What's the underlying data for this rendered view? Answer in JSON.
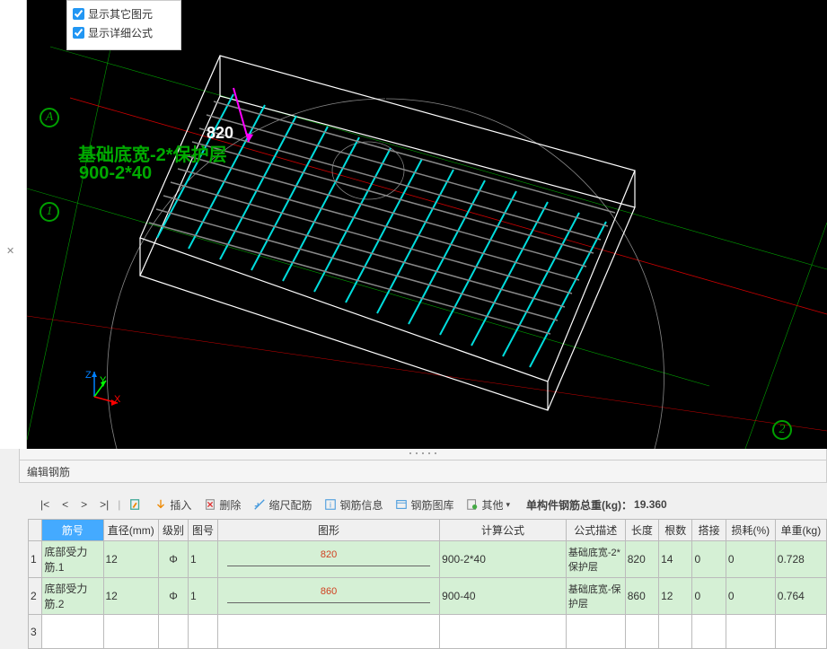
{
  "overlay": {
    "opt1": "显示其它图元",
    "opt2": "显示详细公式"
  },
  "viewport": {
    "dim820": "820",
    "formula_label": "基础底宽-2*保护层",
    "formula_calc": "900-2*40",
    "axis_x": "X",
    "axis_y": "Y",
    "axis_z": "Z",
    "marker_a": "A",
    "marker_1": "1",
    "marker_2": "2"
  },
  "panel_title": "编辑钢筋",
  "toolbar": {
    "first": "|<",
    "prev": "<",
    "next": ">",
    "last": ">|",
    "insert": "插入",
    "delete": "删除",
    "scale": "缩尺配筋",
    "info": "钢筋信息",
    "lib": "钢筋图库",
    "other": "其他",
    "total_label": "单构件钢筋总重(kg)：",
    "total_value": "19.360"
  },
  "grid": {
    "headers": {
      "h1": "筋号",
      "h2": "直径(mm)",
      "h3": "级别",
      "h4": "图号",
      "h5": "图形",
      "h6": "计算公式",
      "h7": "公式描述",
      "h8": "长度",
      "h9": "根数",
      "h10": "搭接",
      "h11": "损耗(%)",
      "h12": "单重(kg)"
    },
    "rows": [
      {
        "num": "1",
        "name": "底部受力筋.1",
        "dia": "12",
        "grade": "Φ",
        "figno": "1",
        "shape_val": "820",
        "formula": "900-2*40",
        "desc": "基础底宽-2*保护层",
        "len": "820",
        "count": "14",
        "lap": "0",
        "loss": "0",
        "weight": "0.728"
      },
      {
        "num": "2",
        "name": "底部受力筋.2",
        "dia": "12",
        "grade": "Φ",
        "figno": "1",
        "shape_val": "860",
        "formula": "900-40",
        "desc": "基础底宽-保护层",
        "len": "860",
        "count": "12",
        "lap": "0",
        "loss": "0",
        "weight": "0.764"
      },
      {
        "num": "3",
        "name": "",
        "dia": "",
        "grade": "",
        "figno": "",
        "shape_val": "",
        "formula": "",
        "desc": "",
        "len": "",
        "count": "",
        "lap": "",
        "loss": "",
        "weight": ""
      }
    ]
  }
}
